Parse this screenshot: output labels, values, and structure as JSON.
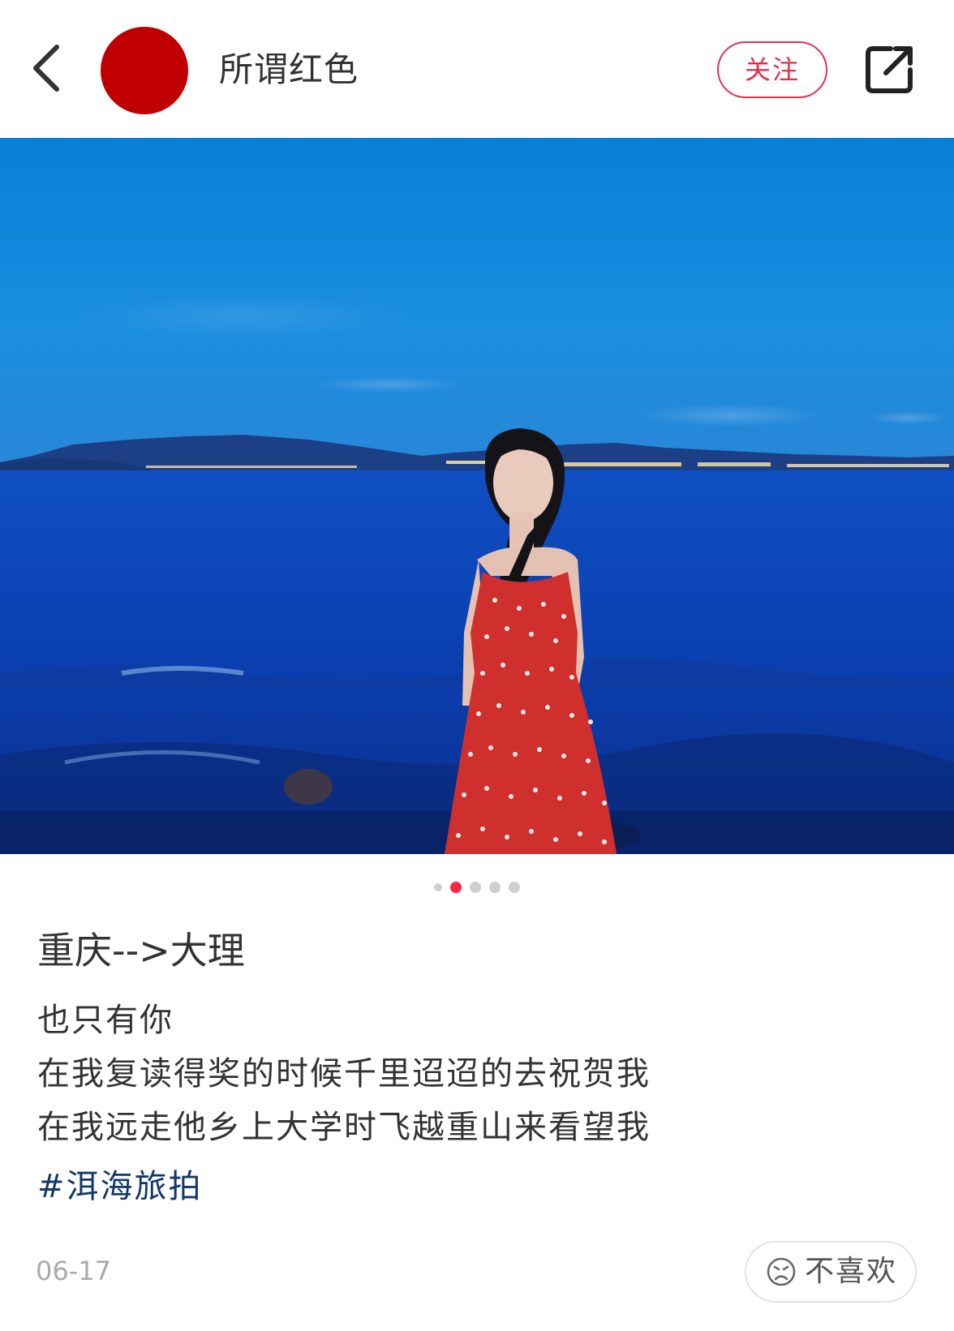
{
  "header": {
    "username": "所谓红色",
    "follow_label": "关注",
    "avatar_color": "#c00000"
  },
  "icons": {
    "back": "chevron-left-icon",
    "share": "share-icon",
    "dislike": "sad-face-icon"
  },
  "carousel": {
    "total": 5,
    "active_index": 1
  },
  "post": {
    "title": "重庆-->大理",
    "body_lines": [
      "也只有你",
      "在我复读得奖的时候千里迢迢的去祝贺我",
      "在我远走他乡上大学时飞越重山来看望我"
    ],
    "hashtag": "#洱海旅拍",
    "date": "06-17"
  },
  "actions": {
    "dislike_label": "不喜欢"
  },
  "colors": {
    "accent": "#ff2442",
    "follow": "#e0304a",
    "hashtag": "#13386c",
    "muted": "#aaaaaa"
  }
}
